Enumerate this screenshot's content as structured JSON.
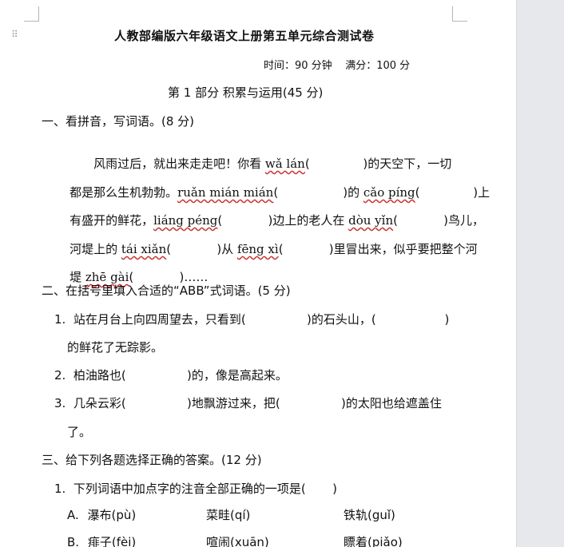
{
  "title": "人教部编版六年级语文上册第五单元综合测试卷",
  "exam_info": "时间：90 分钟    满分：100 分",
  "part1": "第 1 部分 积累与运用(45 分)",
  "sec1": {
    "heading": "一、看拼音，写词语。(8 分)",
    "l1": {
      "pre": "风雨过后，就出来走走吧！你看 ",
      "p1": "wǎ lán",
      "post": "(              )的天空下，一切"
    },
    "l2": {
      "pre": "都是那么生机勃勃。",
      "p1": "ruǎn mián mián",
      "mid": "(                 )的 ",
      "p2": "cǎo píng",
      "post": "(              )上"
    },
    "l3": {
      "pre": "有盛开的鲜花，",
      "p1": "liáng péng",
      "mid": "(            )边上的老人在 ",
      "p2": "dòu yǐn",
      "post": "(            )鸟儿，"
    },
    "l4": {
      "pre": "河堤上的 ",
      "p1": "tái xiǎn",
      "mid": "(            )从 ",
      "p2": "fēng xì",
      "post": "(            )里冒出来，似乎要把整个河"
    },
    "l5": {
      "pre": "堤 ",
      "p1": "zhē gài",
      "post": "(            )……"
    }
  },
  "sec2": {
    "heading": "二、在括号里填入合适的“ABB”式词语。(5 分)",
    "q1a": "1.  站在月台上向四周望去，只看到(                )的石头山，(                  )",
    "q1b": "的鲜花了无踪影。",
    "q2": "2.  柏油路也(                )的，像是高起来。",
    "q3a": "3.  几朵云彩(                )地飘游过来，把(                )的太阳也给遮盖住",
    "q3b": "了。"
  },
  "sec3": {
    "heading": "三、给下列各题选择正确的答案。(12 分)",
    "q1": "1.  下列词语中加点字的注音全部正确的一项是(       )",
    "optA": {
      "label": "A.",
      "w1": "瀑布(pù)",
      "w2": "菜畦(qí)",
      "w3": "铁轨(guǐ)"
    },
    "optB": {
      "label": "B.",
      "w1": "痱子(fèi)",
      "w2": "喧闹(xuān)",
      "w3": "瞟着(piǎo)"
    }
  }
}
